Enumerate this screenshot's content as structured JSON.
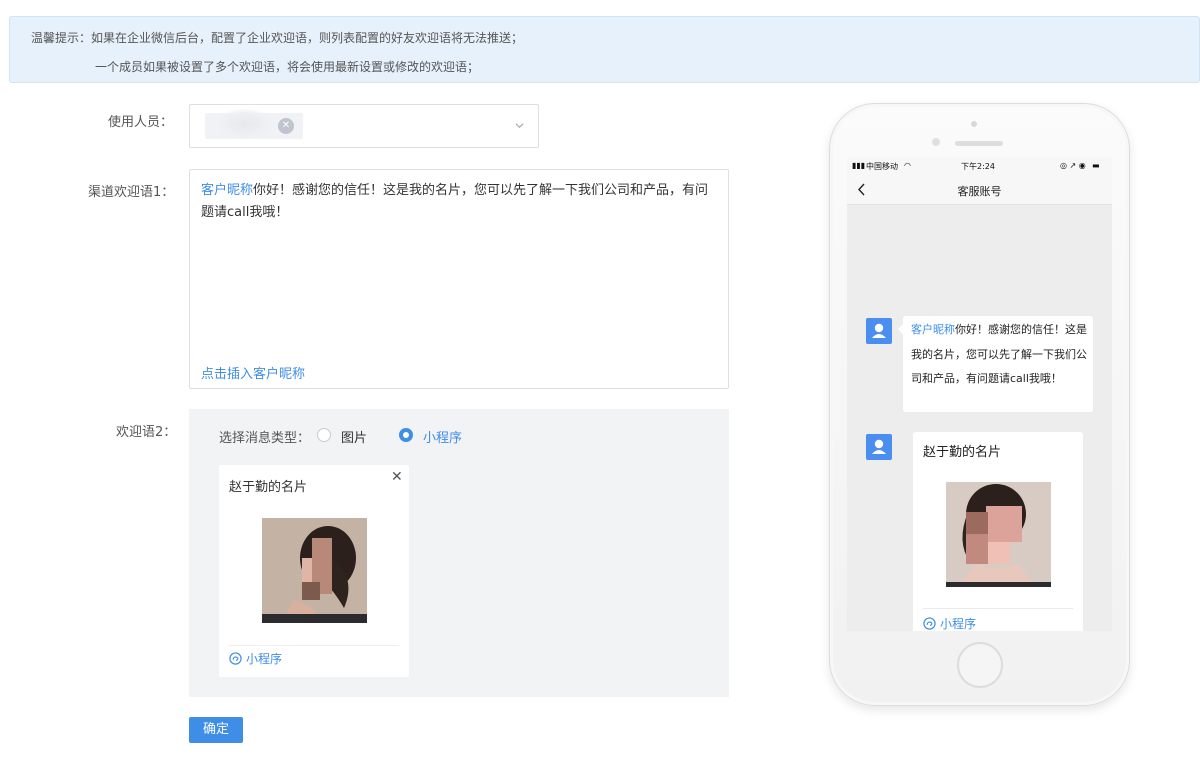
{
  "notice": {
    "line1": "温馨提示：如果在企业微信后台，配置了企业欢迎语，则列表配置的好友欢迎语将无法推送；",
    "line2": "一个成员如果被设置了多个欢迎语，将会使用最新设置或修改的欢迎语；"
  },
  "form": {
    "user_label": "使用人员：",
    "welcome1_label": "渠道欢迎语1：",
    "welcome1_nickname": "客户昵称",
    "welcome1_text": "你好！感谢您的信任！这是我的名片，您可以先了解一下我们公司和产品，有问题请call我哦！",
    "insert_link": "点击插入客户昵称",
    "welcome2_label": "欢迎语2：",
    "type_label": "选择消息类型：",
    "type_options": [
      "图片",
      "小程序"
    ],
    "selected_type": "小程序",
    "card_title": "赵于勤的名片",
    "card_footer": "小程序",
    "confirm_button": "确定"
  },
  "phone": {
    "carrier": "中国移动",
    "time": "下午2:24",
    "title": "客服账号",
    "bubble_nickname": "客户昵称",
    "bubble_text": "你好！感谢您的信任！这是我的名片，您可以先了解一下我们公司和产品，有问题请call我哦！",
    "card_title": "赵于勤的名片",
    "card_footer": "小程序"
  },
  "colors": {
    "accent": "#3e8ee8",
    "notice_bg": "#e6f1fc",
    "panel_bg": "#f2f3f5"
  }
}
